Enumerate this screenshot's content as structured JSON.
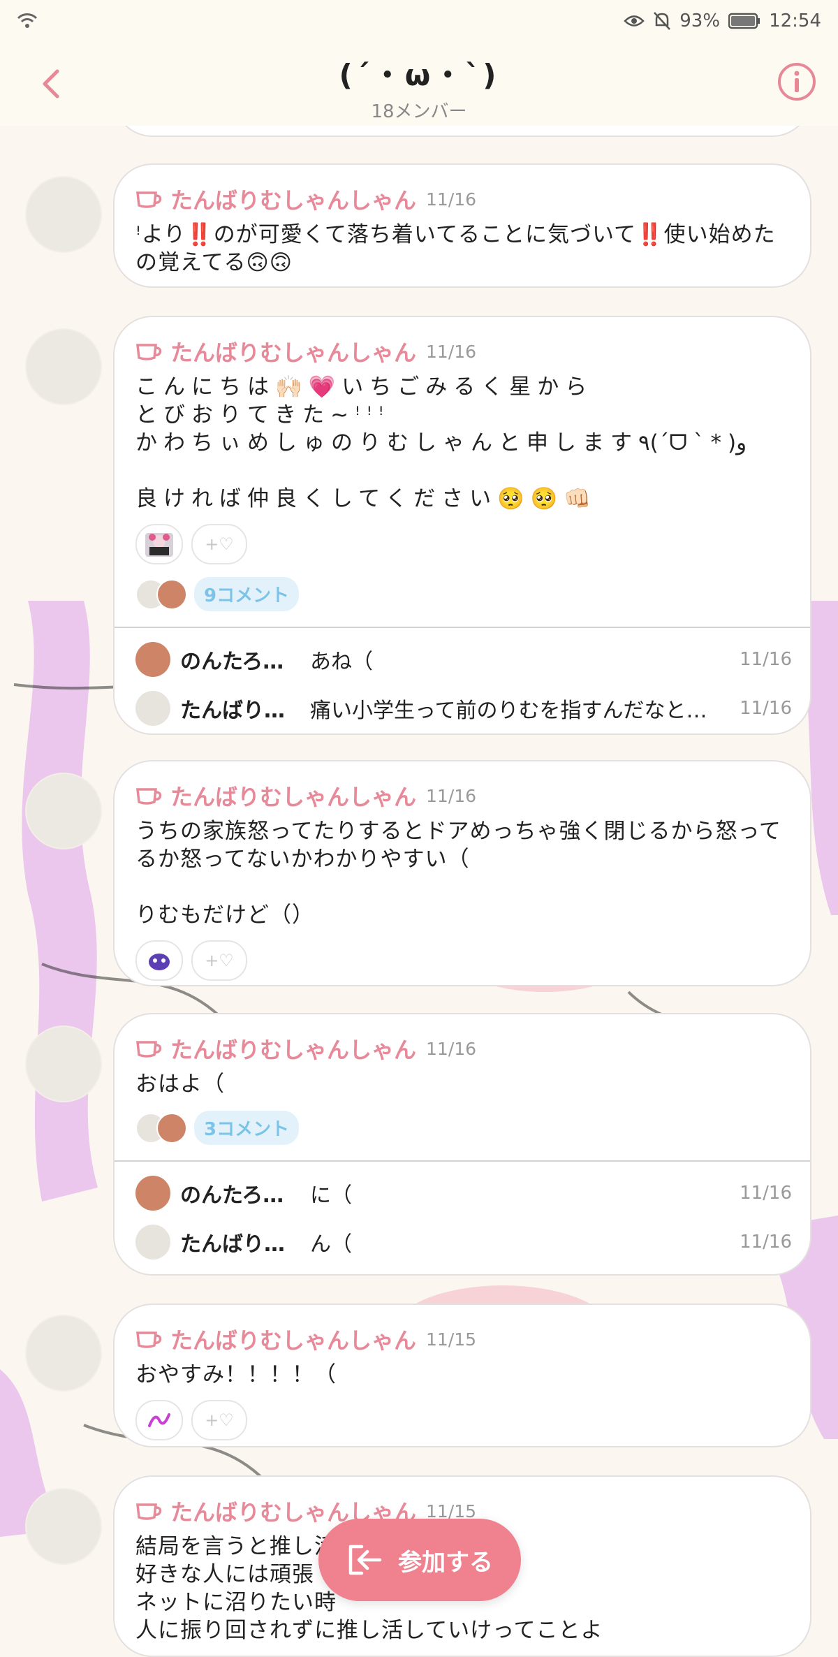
{
  "status": {
    "battery": "93%",
    "time": "12:54"
  },
  "header": {
    "title": "(´・ω・`)",
    "members": "18メンバー"
  },
  "posts": [
    {
      "author": "たんばりむしゃんしゃん",
      "date": "11/16",
      "text": "ꜝより‼️のが可愛くて落ち着いてることに気づいて‼️使い始めたの覚えてる🙃🙃"
    },
    {
      "author": "たんばりむしゃんしゃん",
      "date": "11/16",
      "text": "こんにちは🙌🏻💗いちごみるく星から\nとびおりてきた~ꜝꜝꜝ\nかわちぃめしゅのりむしゃんと申します٩(ˊᗜˋ*)و\n\n良ければ仲良くしてください🥺🥺👊🏻",
      "comment_count": "9コメント",
      "replies": [
        {
          "name": "のんたろ…",
          "text": "あね（",
          "date": "11/16"
        },
        {
          "name": "たんばり…",
          "text": "痛い小学生って前のりむを指すんだなと…",
          "date": "11/16"
        }
      ]
    },
    {
      "author": "たんばりむしゃんしゃん",
      "date": "11/16",
      "text": "うちの家族怒ってたりするとドアめっちゃ強く閉じるから怒ってるか怒ってないかわかりやすい（\n\nりむもだけど（）"
    },
    {
      "author": "たんばりむしゃんしゃん",
      "date": "11/16",
      "text": "おはよ（",
      "comment_count": "3コメント",
      "replies": [
        {
          "name": "のんたろ…",
          "text": "に（",
          "date": "11/16"
        },
        {
          "name": "たんばり…",
          "text": "ん（",
          "date": "11/16"
        }
      ]
    },
    {
      "author": "たんばりむしゃんしゃん",
      "date": "11/15",
      "text": "おやすみ！！！！（"
    },
    {
      "author": "たんばりむしゃんしゃん",
      "date": "11/15",
      "text": "結局を言うと推し活\n好きな人には頑張\nネットに沼りたい時\n人に振り回されずに推し活していけってことよ"
    }
  ],
  "add_reaction_label": "+♡",
  "join_button": "参加する",
  "colors": {
    "accent": "#f0828f",
    "author": "#e68a9a",
    "comment_pill": "#7cc3e8"
  }
}
